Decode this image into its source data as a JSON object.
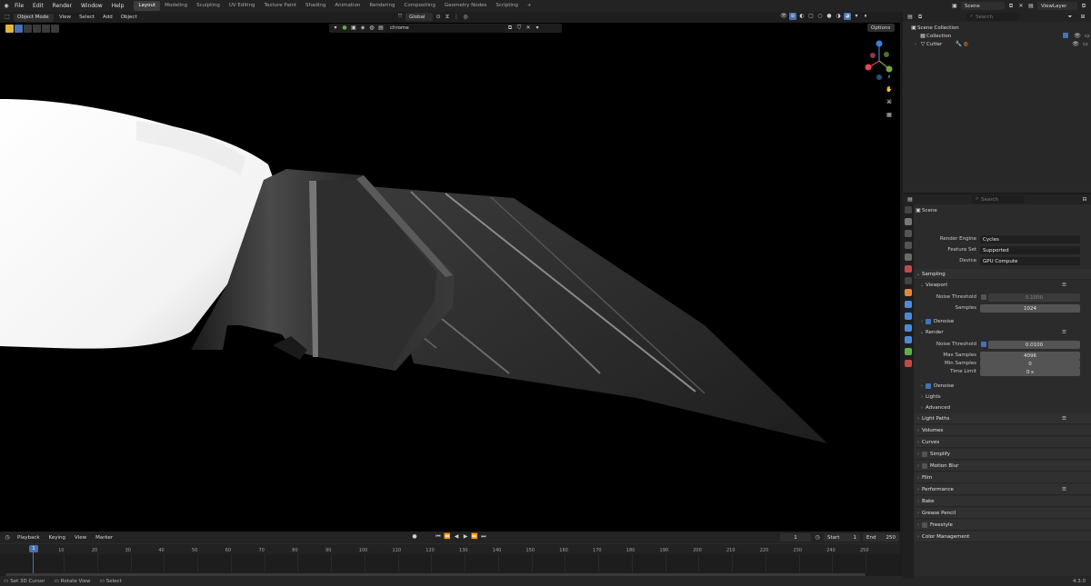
{
  "topbar": {
    "menus": [
      "File",
      "Edit",
      "Render",
      "Window",
      "Help"
    ],
    "workspaces": [
      "Layout",
      "Modeling",
      "Sculpting",
      "UV Editing",
      "Texture Paint",
      "Shading",
      "Animation",
      "Rendering",
      "Compositing",
      "Geometry Nodes",
      "Scripting"
    ],
    "active_workspace": "Layout",
    "add_tab": "+",
    "scene_name": "Scene",
    "view_layer": "ViewLayer"
  },
  "viewport": {
    "mode": "Object Mode",
    "menus": [
      "View",
      "Select",
      "Add",
      "Object"
    ],
    "orientation": "Global",
    "material_search": "chrome",
    "options_label": "Options"
  },
  "timeline": {
    "menus": [
      "Playback",
      "Keying",
      "View",
      "Marker"
    ],
    "current_frame": "1",
    "start_label": "Start",
    "start_value": "1",
    "end_label": "End",
    "end_value": "250",
    "ruler_ticks": [
      "1",
      "10",
      "20",
      "30",
      "40",
      "50",
      "60",
      "70",
      "80",
      "90",
      "100",
      "110",
      "120",
      "130",
      "140",
      "150",
      "160",
      "170",
      "180",
      "190",
      "200",
      "210",
      "220",
      "230",
      "240",
      "250"
    ]
  },
  "statusbar": {
    "items": [
      "Set 3D Cursor",
      "Rotate View",
      "Select"
    ],
    "version": "4.3.0"
  },
  "outliner": {
    "search_placeholder": "Search",
    "rows": [
      "Scene Collection",
      "Collection",
      "Cutter"
    ]
  },
  "properties": {
    "search_placeholder": "Search",
    "context": "Scene",
    "render_engine_label": "Render Engine",
    "render_engine": "Cycles",
    "feature_set_label": "Feature Set",
    "feature_set": "Supported",
    "device_label": "Device",
    "device": "GPU Compute",
    "sampling": "Sampling",
    "viewport": "Viewport",
    "vp_noise_label": "Noise Threshold",
    "vp_noise_value": "0.1000",
    "vp_samples_label": "Samples",
    "vp_samples_value": "1024",
    "denoise": "Denoise",
    "render": "Render",
    "r_noise_label": "Noise Threshold",
    "r_noise_value": "0.0100",
    "max_samples_label": "Max Samples",
    "max_samples_value": "4096",
    "min_samples_label": "Min Samples",
    "min_samples_value": "0",
    "time_limit_label": "Time Limit",
    "time_limit_value": "0 s",
    "denoise2": "Denoise",
    "lights": "Lights",
    "advanced": "Advanced",
    "panels": [
      "Light Paths",
      "Volumes",
      "Curves",
      "Simplify",
      "Motion Blur",
      "Film",
      "Performance",
      "Bake",
      "Grease Pencil",
      "Freestyle",
      "Color Management"
    ]
  },
  "colors": {
    "accent": "#4772b3",
    "gizmo_x": "#e0484e",
    "gizmo_y": "#72a83a",
    "gizmo_z": "#3c7fd6"
  }
}
